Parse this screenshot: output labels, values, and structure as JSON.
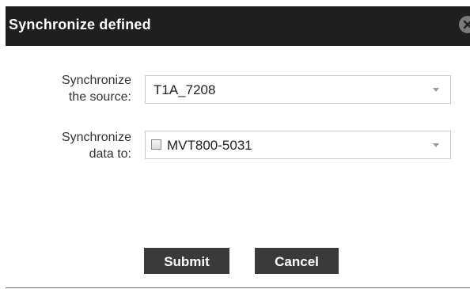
{
  "dialog": {
    "title": "Synchronize defined",
    "close_icon": "close-circle-icon"
  },
  "source_row": {
    "label_line1": "Synchronize",
    "label_line2": "the source:",
    "value": "T1A_7208"
  },
  "target_row": {
    "label_line1": "Synchronize",
    "label_line2": "data to:",
    "value": "MVT800-5031",
    "checked": false
  },
  "buttons": {
    "submit": "Submit",
    "cancel": "Cancel"
  },
  "colors": {
    "title_bar": "#1f1f1f",
    "button": "#3a3a3a"
  }
}
